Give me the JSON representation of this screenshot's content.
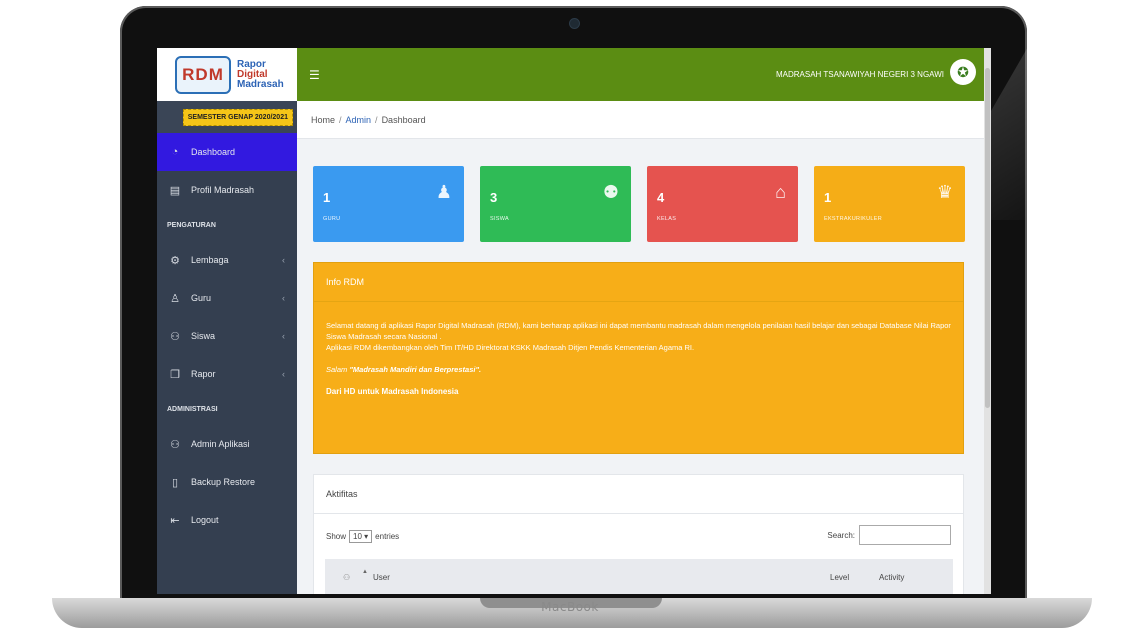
{
  "device": {
    "brand": "MacBook"
  },
  "app": {
    "logo_text": "RDM",
    "logo_name_line1": "Rapor",
    "logo_name_line2": "Digital",
    "logo_name_line3": "Madrasah",
    "semester": "SEMESTER GENAP 2020/2021",
    "institution": "MADRASAH TSANAWIYAH NEGERI 3 NGAWI"
  },
  "sidebar": {
    "items": [
      {
        "label": "Dashboard",
        "icon": "dashboard-icon"
      },
      {
        "label": "Profil Madrasah",
        "icon": "building-icon"
      }
    ],
    "section_settings": "PENGATURAN",
    "settings_items": [
      {
        "label": "Lembaga",
        "icon": "cogs-icon"
      },
      {
        "label": "Guru",
        "icon": "user-icon"
      },
      {
        "label": "Siswa",
        "icon": "users-icon"
      },
      {
        "label": "Rapor",
        "icon": "document-icon"
      }
    ],
    "section_admin": "ADMINISTRASI",
    "admin_items": [
      {
        "label": "Admin Aplikasi",
        "icon": "users-icon"
      },
      {
        "label": "Backup Restore",
        "icon": "file-icon"
      },
      {
        "label": "Logout",
        "icon": "logout-icon"
      }
    ]
  },
  "breadcrumb": {
    "home": "Home",
    "admin": "Admin",
    "current": "Dashboard"
  },
  "cards": [
    {
      "value": "1",
      "label": "GURU",
      "icon": "user-icon",
      "color": "#3a9af0"
    },
    {
      "value": "3",
      "label": "SISWA",
      "icon": "users-icon",
      "color": "#2fbb56"
    },
    {
      "value": "4",
      "label": "KELAS",
      "icon": "bank-icon",
      "color": "#e5534f"
    },
    {
      "value": "1",
      "label": "EKSTRAKURIKULER",
      "icon": "trophy-icon",
      "color": "#f5ad17"
    }
  ],
  "info": {
    "title": "Info RDM",
    "p1": "Selamat datang di aplikasi Rapor Digital Madrasah (RDM), kami berharap aplikasi ini dapat membantu madrasah dalam mengelola penilaian hasil belajar dan sebagai Database Nilai Rapor Siswa Madrasah secara Nasional .",
    "p2": "Aplikasi RDM dikembangkan oleh Tim IT/HD Direktorat KSKK Madrasah Ditjen Pendis Kementerian Agama RI.",
    "salam_prefix": "Salam",
    "salam_motto": "\"Madrasah Mandiri dan Berprestasi\".",
    "signature": "Dari HD untuk Madrasah Indonesia"
  },
  "activity": {
    "title": "Aktifitas",
    "show_label": "Show",
    "entries_value": "10",
    "entries_label": "entries",
    "search_label": "Search:",
    "columns": {
      "user": "User",
      "level": "Level",
      "activity": "Activity"
    }
  }
}
